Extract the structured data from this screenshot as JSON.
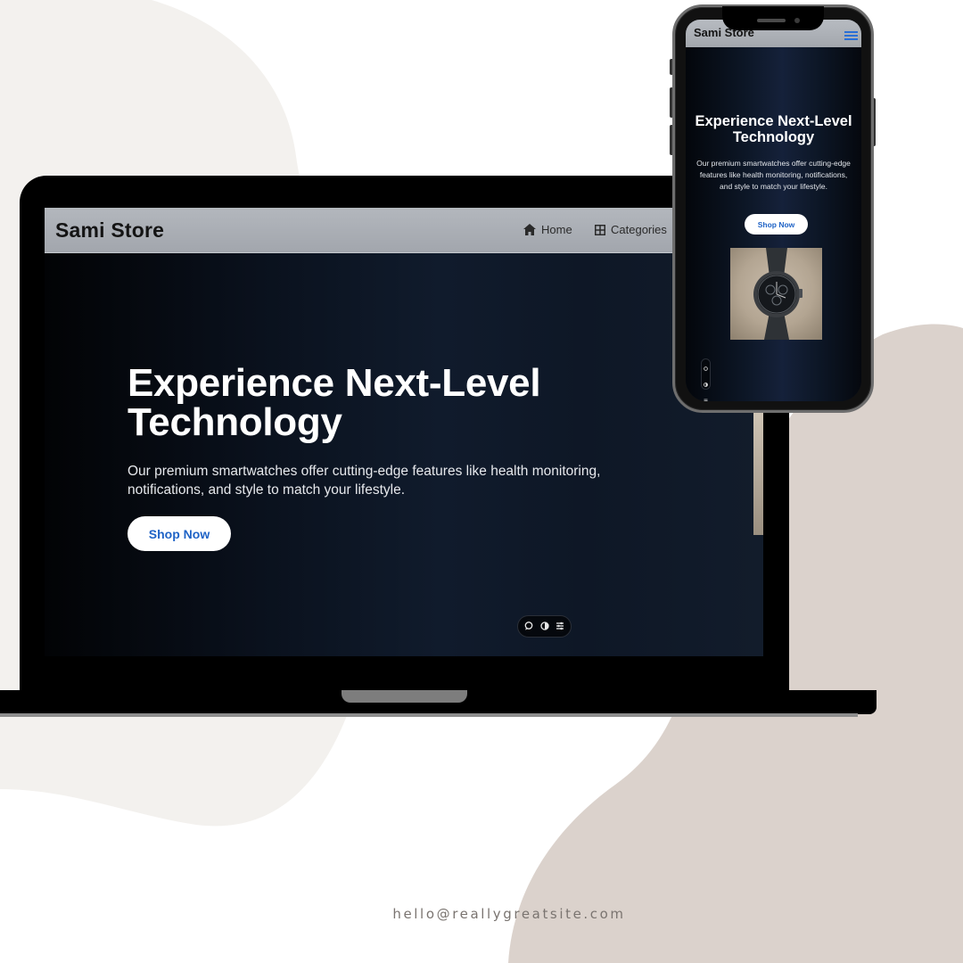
{
  "desktop": {
    "brand": "Sami Store",
    "nav": [
      {
        "label": "Home",
        "icon": "home-icon"
      },
      {
        "label": "Categories",
        "icon": "grid-icon"
      }
    ],
    "hero": {
      "title": "Experience Next-Level Technology",
      "description": "Our premium smartwatches offer cutting-edge features like health monitoring, notifications, and style to match your lifestyle.",
      "cta": "Shop Now"
    },
    "toolbar_icons": [
      "chat-icon",
      "contrast-icon",
      "settings-icon"
    ]
  },
  "mobile": {
    "brand": "Sami Store",
    "menu_icon": "hamburger-menu-icon",
    "hero": {
      "title": "Experience Next-Level Technology",
      "description": "Our premium smartwatches offer cutting-edge features like health monitoring, notifications, and style to match your lifestyle.",
      "cta": "Shop Now"
    },
    "product_image": "smartwatch-image",
    "toolbar_icons": [
      "chat-icon",
      "contrast-icon",
      "settings-icon"
    ]
  },
  "footer": {
    "email": "hello@reallygreatsite.com"
  },
  "colors": {
    "accent": "#1f63c6",
    "hero_bg": "#0b1422",
    "nav_bg": "#a7abb1",
    "blob_left": "#f3f1ee",
    "blob_right": "#dbd2cc"
  }
}
